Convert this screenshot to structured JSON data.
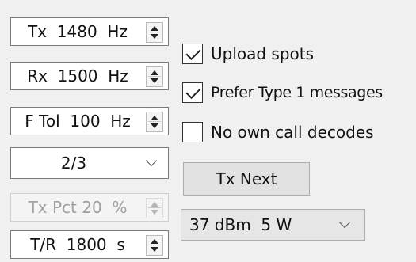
{
  "left_column": {
    "tx_freq": {
      "value": "Tx  1480  Hz"
    },
    "rx_freq": {
      "value": "Rx  1500  Hz"
    },
    "f_tol": {
      "value": "F Tol  100  Hz"
    },
    "period_select": {
      "value": "2/3"
    },
    "tx_pct": {
      "value": "Tx Pct 20  %",
      "enabled": false
    },
    "tr_period": {
      "value": "T/R  1800  s"
    }
  },
  "right_column": {
    "upload_spots": {
      "label": "Upload spots",
      "checked": true
    },
    "prefer_type1": {
      "label": "Prefer Type 1 messages",
      "checked": true
    },
    "no_own_call": {
      "label": "No own call decodes",
      "checked": false
    },
    "tx_next_label": "Tx Next",
    "power_select": {
      "value": "37 dBm  5 W"
    }
  },
  "icons": [
    "spin-up-icon",
    "spin-down-icon",
    "chevron-down-icon",
    "checkmark-icon"
  ]
}
